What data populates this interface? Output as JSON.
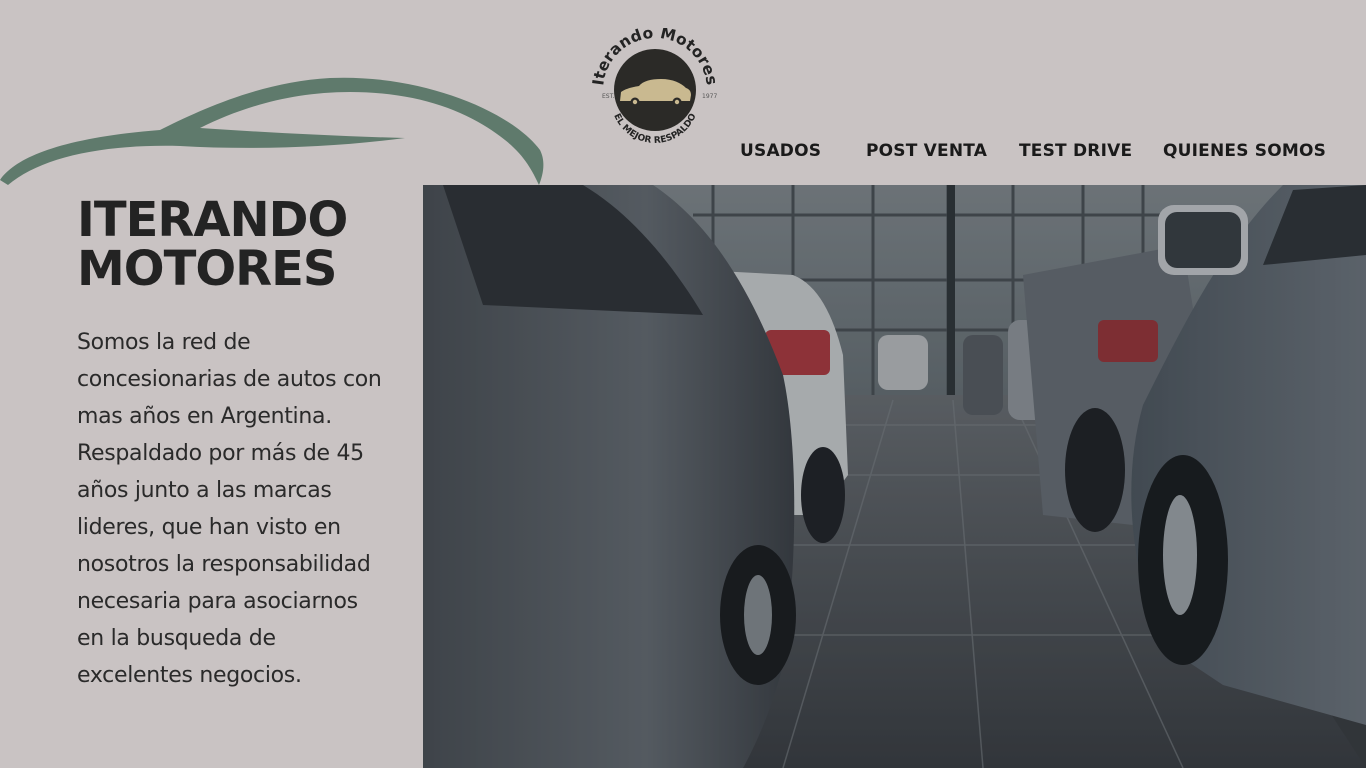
{
  "brand": {
    "logo_name": "Iterando Motores",
    "logo_tagline": "EL MEJOR RESPALDO",
    "logo_est": "EST.",
    "logo_year": "1977",
    "accent_color": "#5f7a6c"
  },
  "nav": {
    "items": [
      {
        "label": "USADOS"
      },
      {
        "label": "POST VENTA"
      },
      {
        "label": "TEST DRIVE"
      },
      {
        "label": "QUIENES SOMOS"
      }
    ]
  },
  "hero": {
    "title": "ITERANDO MOTORES",
    "description": "Somos la red de concesionarias de autos con mas años en Argentina. Respaldado por más de 45 años junto a las marcas lideres, que han visto en nosotros la responsabilidad necesaria para asociarnos en la busqueda de excelentes negocios."
  }
}
